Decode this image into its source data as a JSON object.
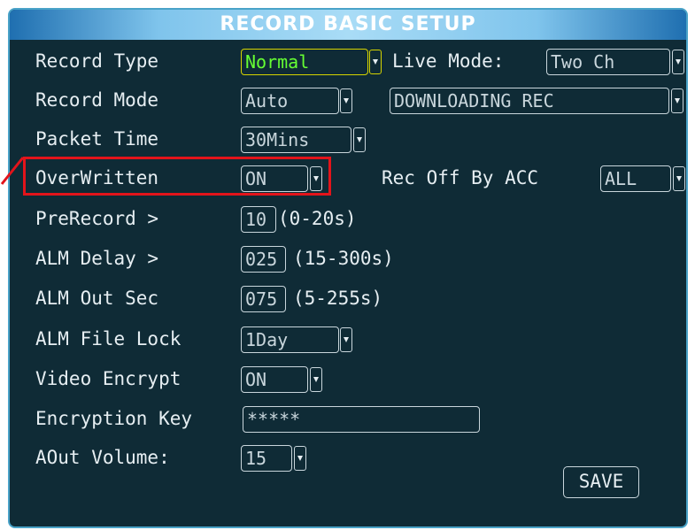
{
  "title": "RECORD BASIC SETUP",
  "fields": {
    "record_type": {
      "label": "Record Type",
      "value": "Normal"
    },
    "live_mode": {
      "label": "Live Mode:",
      "value": "Two Ch"
    },
    "record_mode": {
      "label": "Record Mode",
      "value": "Auto"
    },
    "downloading": {
      "value": "DOWNLOADING REC"
    },
    "packet_time": {
      "label": "Packet Time",
      "value": "30Mins"
    },
    "overwritten": {
      "label": "OverWritten",
      "value": "ON"
    },
    "rec_off_acc": {
      "label": "Rec Off By ACC",
      "value": "ALL"
    },
    "prerecord": {
      "label": "PreRecord >",
      "value": "10",
      "range": "(0-20s)"
    },
    "alm_delay": {
      "label": "ALM Delay >",
      "value": "025",
      "range": "(15-300s)"
    },
    "alm_out_sec": {
      "label": "ALM Out Sec",
      "value": "075",
      "range": "(5-255s)"
    },
    "alm_file_lock": {
      "label": "ALM File Lock",
      "value": "1Day"
    },
    "video_encrypt": {
      "label": "Video Encrypt",
      "value": "ON"
    },
    "encryption_key": {
      "label": "Encryption Key",
      "value": "*****"
    },
    "aout_volume": {
      "label": "AOut Volume:",
      "value": "15"
    }
  },
  "save_label": "SAVE",
  "colors": {
    "panel_bg": "#0f2b36",
    "text": "#e6eef2",
    "selected_text": "#66ff33",
    "selected_border": "#d6d400",
    "annotation": "#e3141b"
  }
}
